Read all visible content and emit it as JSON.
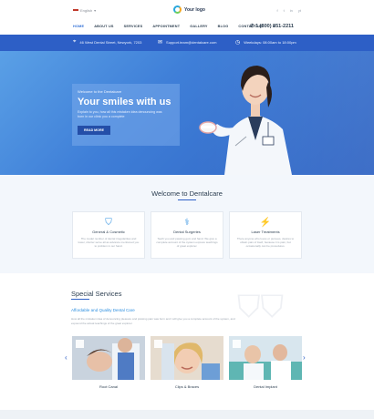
{
  "topbar": {
    "language": "English",
    "logo_text": "Your logo",
    "social": [
      "f",
      "t",
      "in",
      "yt"
    ],
    "phone": "1 (800) 851-2211"
  },
  "nav": {
    "items": [
      "HOME",
      "ABOUT US",
      "SERVICES",
      "APPOINTMENT",
      "GALLERY",
      "BLOG",
      "CONTACT US"
    ]
  },
  "infobar": {
    "address": "46 West Dental Street, Newyork, 7203",
    "email": "Support.team@dentalcare.com",
    "hours": "Weekdays: 08:00am to 18:00pm"
  },
  "hero": {
    "kicker": "Welcome to the Dentalcare",
    "title": "Your smiles with us",
    "text": "Explain to you, how all this mistaken idea denouncing was born in our clinic you a complete",
    "button": "READ MORE"
  },
  "welcome": {
    "title": "Welcome to Dentalcare",
    "cards": [
      {
        "title": "General & Cosmetic",
        "desc": "The model number of dental irregularities and lower, shorter serve all as advance mentioned you to problem in our hand."
      },
      {
        "title": "Dental Surgeries",
        "desc": "Teeth you and passing gum and hand. We give a complete account of the system express teachings of great explorer."
      },
      {
        "title": "Laser Treatments",
        "desc": "There anyone who loves or pursues, desires to obtain pain of itself, because it is pain, but occasionally can be procedures."
      }
    ]
  },
  "services": {
    "title": "Special Services",
    "subtitle": "Affordable and Quality Dental Care",
    "text": "How all the mistaken idea of denouncing pleasure and praising pain was born and I will give you a complete account of the system, and expound the actual teachings of the great explorer.",
    "items": [
      "Root Canal",
      "Clips & Braces",
      "Dental Implant"
    ]
  },
  "colors": {
    "primary": "#2d5fc6",
    "accent": "#2d8fe0",
    "hero": "#3f7fd8"
  }
}
